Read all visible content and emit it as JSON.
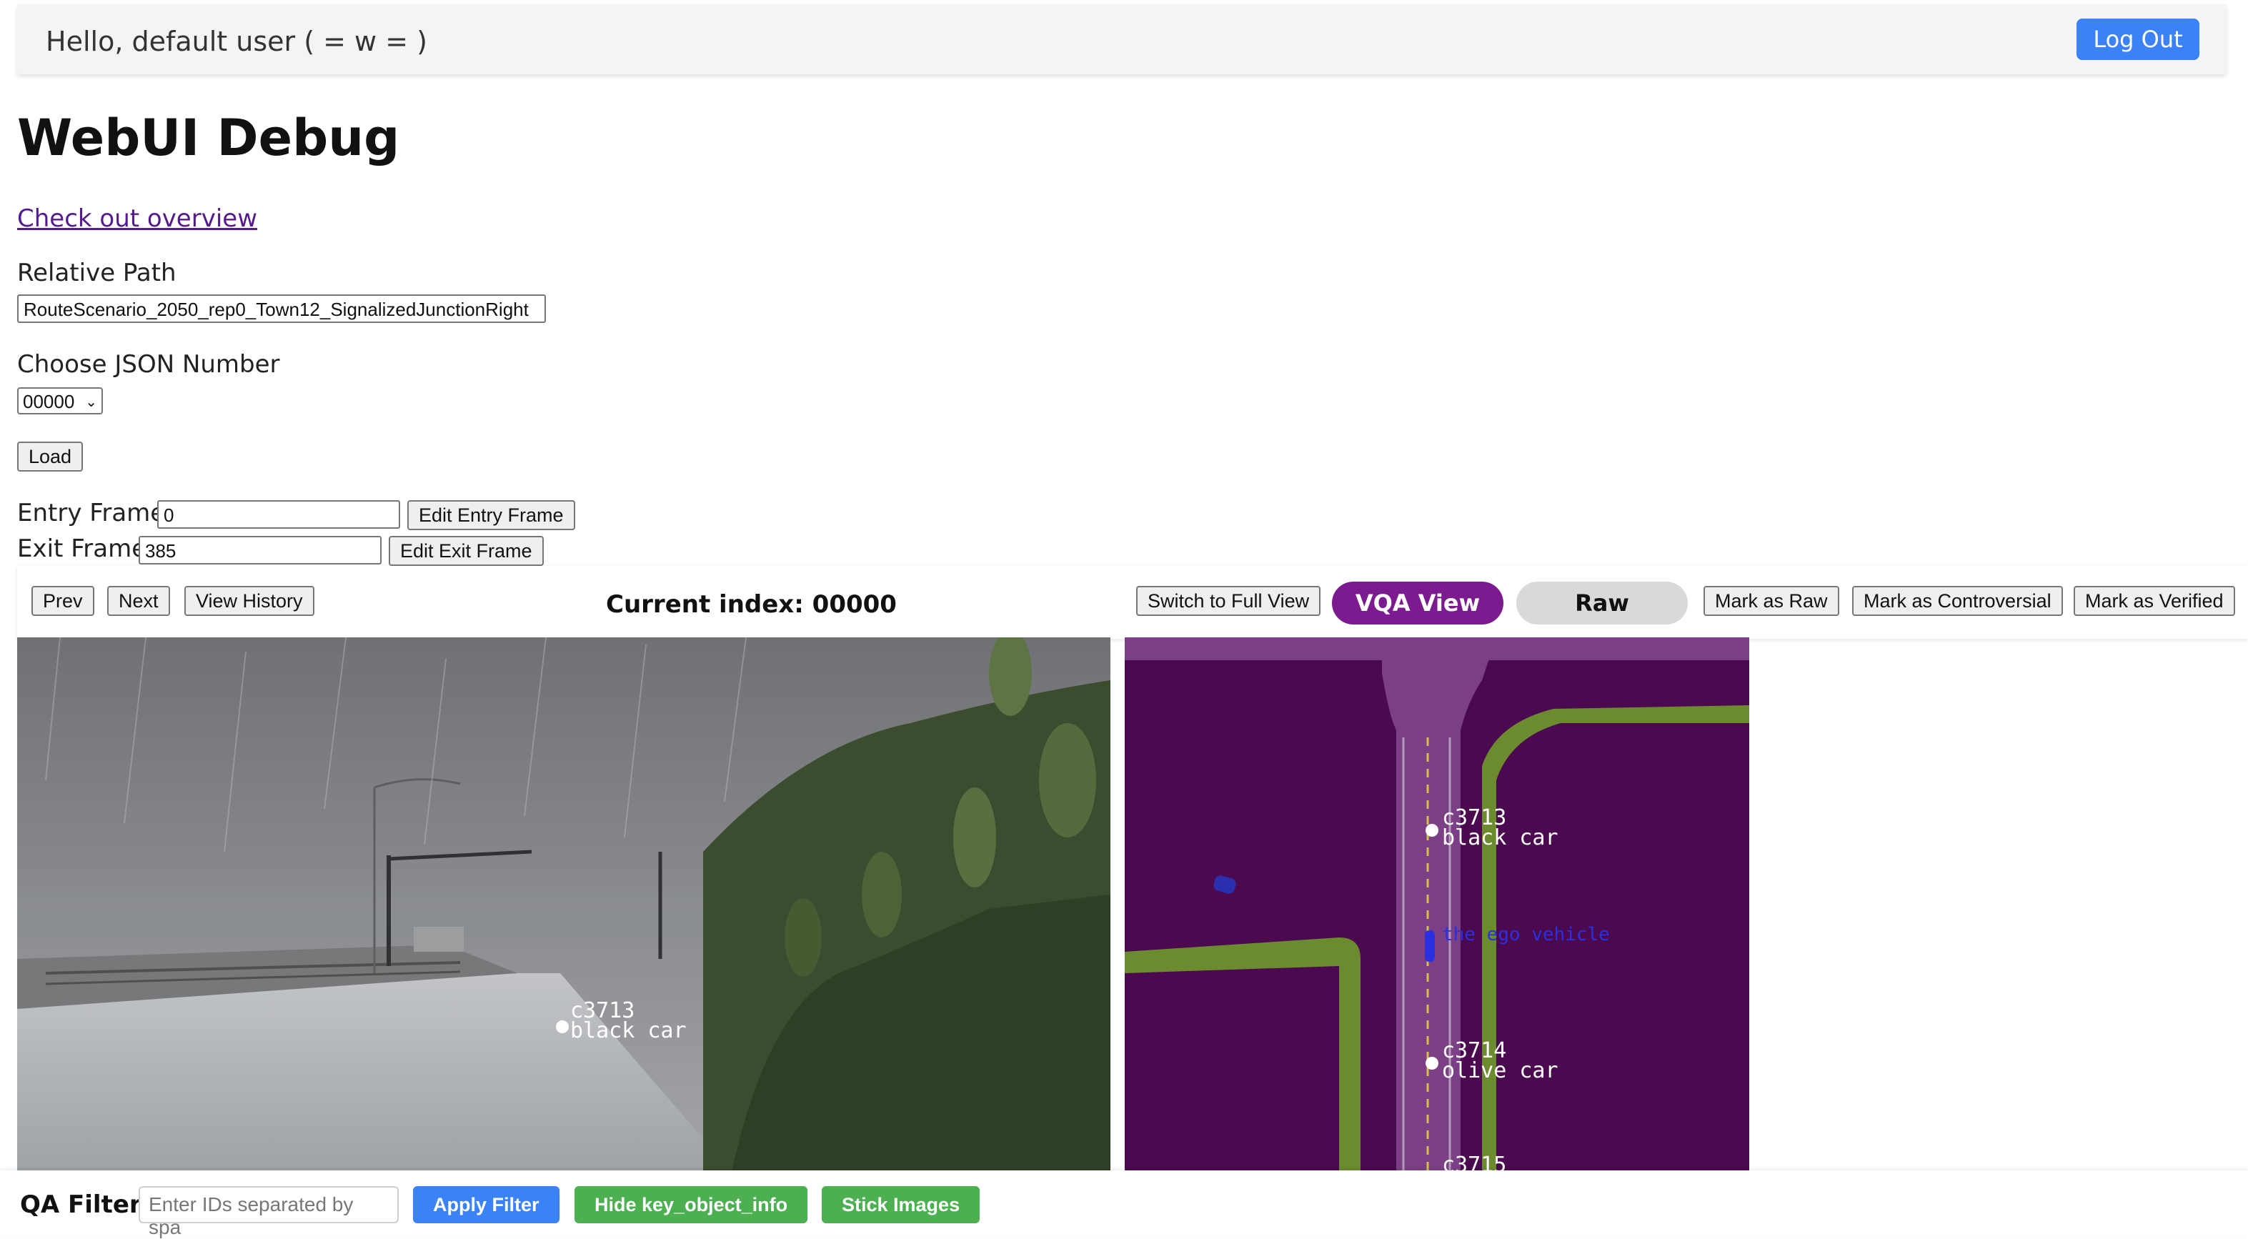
{
  "header": {
    "greeting": "Hello, default user ( = w = )",
    "logout_label": "Log Out"
  },
  "page": {
    "title": "WebUI Debug",
    "overview_link": "Check out overview"
  },
  "form": {
    "relative_path_label": "Relative Path",
    "relative_path_value": "RouteScenario_2050_rep0_Town12_SignalizedJunctionRight",
    "json_number_label": "Choose JSON Number",
    "json_number_selected": "00000",
    "load_label": "Load",
    "entry_frame_label": "Entry Frame:",
    "entry_frame_value": "0",
    "edit_entry_label": "Edit Entry Frame",
    "exit_frame_label": "Exit Frame:",
    "exit_frame_value": "385",
    "edit_exit_label": "Edit Exit Frame"
  },
  "toolbar": {
    "prev_label": "Prev",
    "next_label": "Next",
    "history_label": "View History",
    "current_index": "Current index: 00000",
    "full_view_label": "Switch to Full View",
    "vqa_view_label": "VQA View",
    "raw_label": "Raw",
    "mark_raw_label": "Mark as Raw",
    "mark_controversial_label": "Mark as Controversial",
    "mark_verified_label": "Mark as Verified"
  },
  "camera_view": {
    "annotations": [
      {
        "id": "c3713",
        "desc": "black car"
      }
    ]
  },
  "bev_view": {
    "annotations": [
      {
        "id": "c3713",
        "desc": "black car"
      },
      {
        "id": "",
        "desc": "the ego vehicle"
      },
      {
        "id": "c3714",
        "desc": "olive car"
      },
      {
        "id": "c3715",
        "desc": ""
      }
    ]
  },
  "footer": {
    "filter_label": "QA Filter:",
    "filter_placeholder": "Enter IDs separated by spa",
    "apply_label": "Apply Filter",
    "hide_label": "Hide key_object_info",
    "stick_label": "Stick Images"
  },
  "colors": {
    "accent_blue": "#3b82f6",
    "vqa_purple": "#7b1b8f",
    "action_green": "#4caf50",
    "bev_background": "#4b0a4f"
  }
}
